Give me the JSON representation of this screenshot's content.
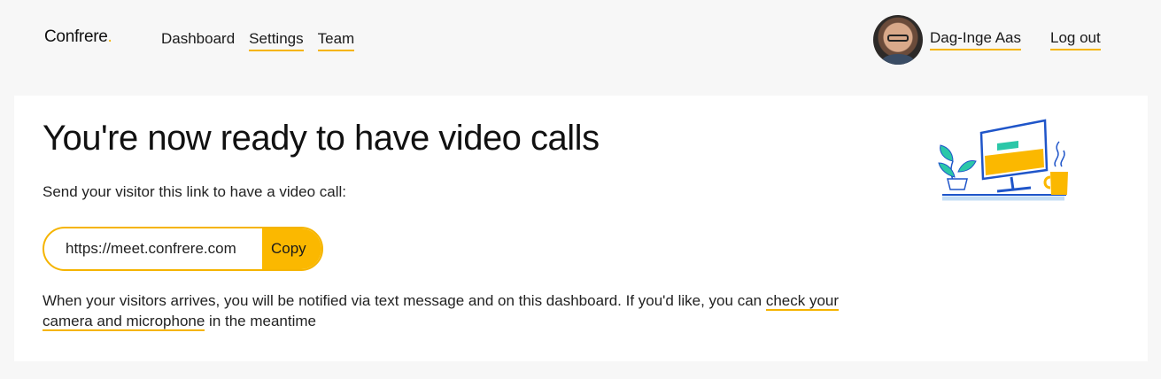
{
  "header": {
    "logo_text": "Confrere",
    "logo_dot": ".",
    "nav": [
      {
        "label": "Dashboard",
        "active": true
      },
      {
        "label": "Settings",
        "active": false
      },
      {
        "label": "Team",
        "active": false
      }
    ],
    "user_name": "Dag-Inge Aas",
    "logout_label": "Log out"
  },
  "main": {
    "title": "You're now ready to have video calls",
    "subtitle": "Send your visitor this link to have a video call:",
    "link_value": "https://meet.confrere.com",
    "copy_label": "Copy",
    "note_before": "When your visitors arrives, you will be notified via text message and on this dashboard. If you'd like, you can ",
    "note_link": "check your camera and microphone",
    "note_after": " in the meantime",
    "illustration_icon": "computer-desk-illustration"
  },
  "colors": {
    "accent": "#f5b400",
    "background": "#f7f7f7",
    "card": "#ffffff",
    "teal": "#2bc7a8",
    "blue": "#1f55c9"
  }
}
